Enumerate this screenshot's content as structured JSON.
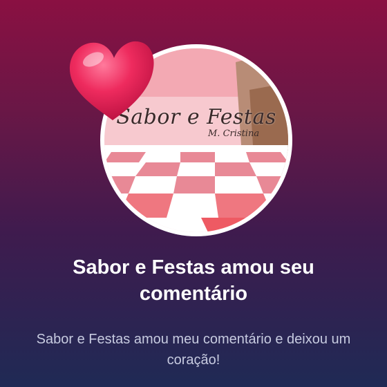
{
  "notification": {
    "title": "Sabor e Festas amou seu comentário",
    "message": "Sabor e Festas amou meu comentário e deixou um coração!"
  },
  "avatar": {
    "brand_text": "Sabor e Festas",
    "sub_text": "M. Cristina",
    "icon": "heart-icon"
  },
  "colors": {
    "heart": "#e8245a",
    "title": "#ffffff",
    "message": "#c7cbe0",
    "gradient_top": "#8a1042",
    "gradient_bottom": "#1f2a55"
  }
}
